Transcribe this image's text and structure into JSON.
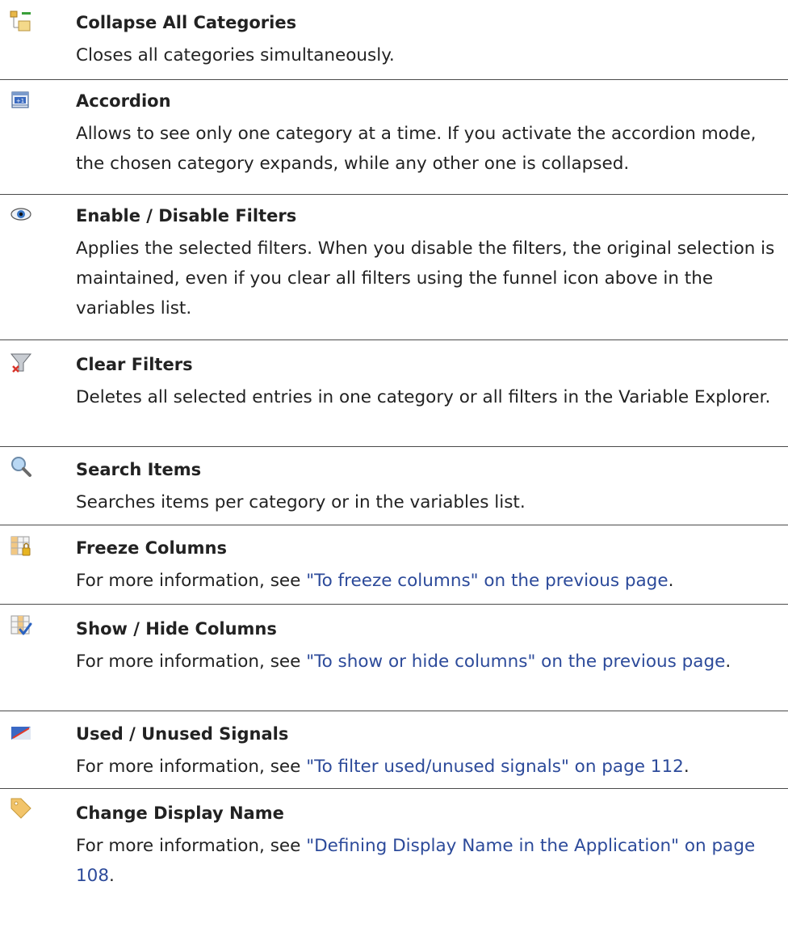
{
  "items": [
    {
      "icon": "collapse-categories-icon",
      "title": "Collapse All Categories",
      "desc": "Closes all categories simultaneously."
    },
    {
      "icon": "accordion-icon",
      "title": "Accordion",
      "desc": "Allows to see only one category at a time. If you activate the accordion mode, the chosen category expands, while any other one is collapsed."
    },
    {
      "icon": "eye-icon",
      "title": "Enable / Disable Filters",
      "desc": "Applies the selected filters. When you disable the filters, the original selection is maintained, even if you clear all filters using the funnel icon above in the variables list."
    },
    {
      "icon": "clear-filter-icon",
      "title": "Clear Filters",
      "desc": "Deletes all selected entries in one category or all filters in the Variable Explorer."
    },
    {
      "icon": "magnifier-icon",
      "title": "Search Items",
      "desc": "Searches items per category or in the variables list."
    },
    {
      "icon": "freeze-columns-icon",
      "title": "Freeze Columns",
      "desc_prefix": "For more information, see ",
      "link": "\"To freeze columns\" on the previous page",
      "desc_suffix": "."
    },
    {
      "icon": "show-hide-columns-icon",
      "title": "Show / Hide Columns",
      "desc_prefix": "For more information, see ",
      "link": "\"To show or hide columns\" on the previous page",
      "desc_suffix": "."
    },
    {
      "icon": "used-signals-icon",
      "title": "Used / Unused Signals",
      "desc_prefix": "For more information, see ",
      "link": "\"To filter used/unused signals\" on page 112",
      "desc_suffix": "."
    },
    {
      "icon": "tag-icon",
      "title": "Change Display Name",
      "desc_prefix": "For more information, see ",
      "link": "\"Defining Display Name in the Application\" on page 108",
      "desc_suffix": "."
    }
  ]
}
